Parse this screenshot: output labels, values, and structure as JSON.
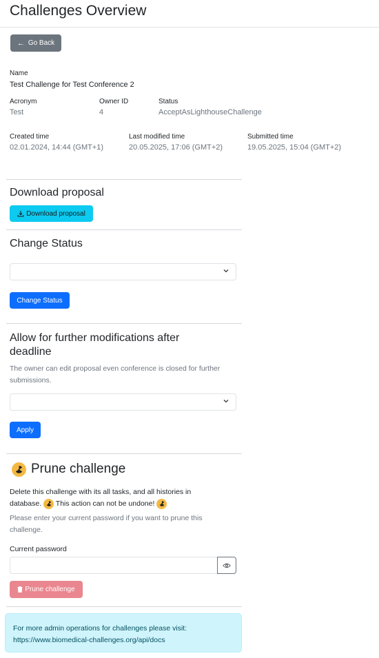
{
  "page": {
    "title": "Challenges Overview"
  },
  "back_button": {
    "label": "Go Back",
    "icon": "arrow-left-icon"
  },
  "details": {
    "name_label": "Name",
    "name_value": "Test Challenge for Test Conference 2",
    "acronym_label": "Acronym",
    "acronym_value": "Test",
    "owner_label": "Owner ID",
    "owner_value": "4",
    "status_label": "Status",
    "status_value": "AcceptAsLighthouseChallenge",
    "created_label": "Created time",
    "created_value": "02.01.2024, 14:44 (GMT+1)",
    "modified_label": "Last modified time",
    "modified_value": "20.05.2025, 17:06 (GMT+2)",
    "submitted_label": "Submitted time",
    "submitted_value": "19.05.2025, 15:04 (GMT+2)"
  },
  "download": {
    "heading": "Download proposal",
    "button_label": "Download proposal",
    "icon": "download-icon"
  },
  "change_status": {
    "heading": "Change Status",
    "select_value": "",
    "button_label": "Change Status"
  },
  "modifications": {
    "heading": "Allow for further modifications after deadline",
    "description": "The owner can edit proposal even conference is closed for further submissions.",
    "select_value": "",
    "button_label": "Apply"
  },
  "prune": {
    "heading": "Prune challenge",
    "icon": "radioactive-icon",
    "warning_part1": "Delete this challenge with its all tasks, and all histories in database.",
    "warning_part2": "This action can not be undone!",
    "hint": "Please enter your current password if you want to prune this challenge.",
    "password_label": "Current password",
    "password_value": "",
    "button_label": "Prune challenge"
  },
  "info": {
    "text": "For more admin operations for challenges please visit:",
    "link": "https://www.biomedical-challenges.org/api/docs"
  },
  "colors": {
    "primary": "#0d6efd",
    "info": "#0dcaf0",
    "secondary": "#6c757d",
    "danger_disabled": "#ea868f",
    "alert_bg": "#cff4fc",
    "alert_text": "#055160"
  }
}
